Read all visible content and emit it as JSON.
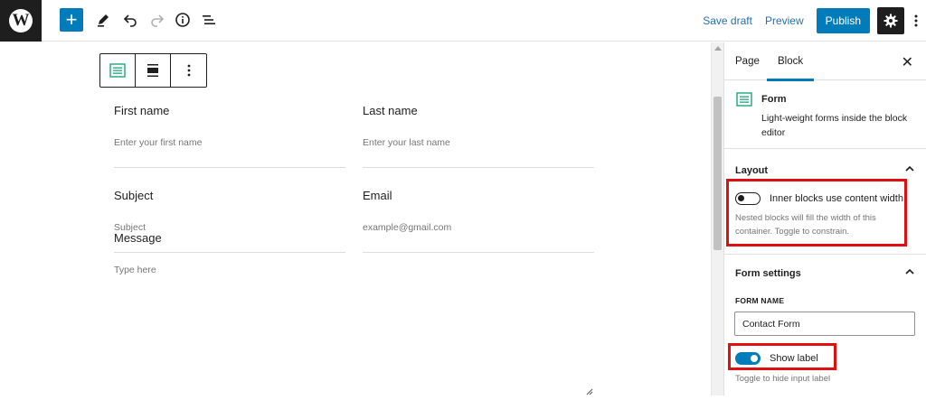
{
  "topbar": {
    "logo_letter": "W",
    "add_button_label": "+",
    "save_draft": "Save draft",
    "preview": "Preview",
    "publish": "Publish"
  },
  "form": {
    "fields": [
      {
        "label": "First name",
        "placeholder": "Enter your first name"
      },
      {
        "label": "Last name",
        "placeholder": "Enter your last name"
      },
      {
        "label": "Subject",
        "placeholder": "Subject"
      },
      {
        "label": "Email",
        "placeholder": "example@gmail.com"
      }
    ],
    "message": {
      "label": "Message",
      "placeholder": "Type here"
    }
  },
  "sidebar": {
    "tabs": [
      {
        "label": "Page"
      },
      {
        "label": "Block"
      }
    ],
    "active_tab": "Block",
    "block": {
      "name": "Form",
      "description": "Light-weight forms inside the block editor"
    },
    "layout_panel": {
      "title": "Layout",
      "toggle_label": "Inner blocks use content width",
      "toggle_on": false,
      "help": "Nested blocks will fill the width of this container. Toggle to constrain."
    },
    "form_settings_panel": {
      "title": "Form settings",
      "form_name_label": "FORM NAME",
      "form_name_value": "Contact Form",
      "show_label_toggle": "Show label",
      "show_label_on": true,
      "show_label_help": "Toggle to hide input label"
    }
  },
  "colors": {
    "accent": "#007cba",
    "highlight": "#e01010",
    "dark": "#1e1e1e"
  }
}
